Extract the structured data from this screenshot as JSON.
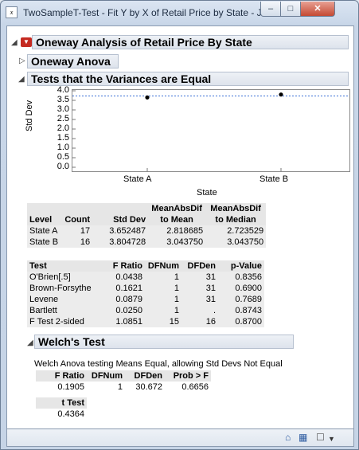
{
  "window": {
    "title": "TwoSampleT-Test - Fit Y by X of Retail Price by State - JMP",
    "controls": {
      "minimize": "–",
      "maximize": "□",
      "close": "✕"
    }
  },
  "report": {
    "main_title": "Oneway Analysis of Retail Price By State",
    "oneway_anova_title": "Oneway Anova",
    "variances_title": "Tests that the Variances are Equal",
    "welch_title": "Welch's Test"
  },
  "chart_data": {
    "type": "scatter",
    "ylabel": "Std Dev",
    "xlabel": "State",
    "ylim": [
      0,
      4
    ],
    "y_ticks": [
      "4.0",
      "3.5",
      "3.0",
      "2.5",
      "2.0",
      "1.5",
      "1.0",
      "0.5",
      "0.0"
    ],
    "categories": [
      "State A",
      "State B"
    ],
    "values": [
      3.652487,
      3.804728
    ],
    "reference_line": 3.73,
    "colors": {
      "points": "#000000",
      "reference_line": "#3b6fd6"
    }
  },
  "std_table": {
    "headers": [
      "Level",
      "Count",
      "Std Dev",
      "MeanAbsDif to Mean",
      "MeanAbsDif to Median"
    ],
    "header_lines": [
      [
        "Level"
      ],
      [
        "Count"
      ],
      [
        "Std Dev"
      ],
      [
        "MeanAbsDif",
        "to Mean"
      ],
      [
        "MeanAbsDif",
        "to Median"
      ]
    ],
    "rows": [
      [
        "State A",
        "17",
        "3.652487",
        "2.818685",
        "2.723529"
      ],
      [
        "State B",
        "16",
        "3.804728",
        "3.043750",
        "3.043750"
      ]
    ]
  },
  "test_table": {
    "headers": [
      "Test",
      "F Ratio",
      "DFNum",
      "DFDen",
      "p-Value"
    ],
    "rows": [
      [
        "O'Brien[.5]",
        "0.0438",
        "1",
        "31",
        "0.8356"
      ],
      [
        "Brown-Forsythe",
        "0.1621",
        "1",
        "31",
        "0.6900"
      ],
      [
        "Levene",
        "0.0879",
        "1",
        "31",
        "0.7689"
      ],
      [
        "Bartlett",
        "0.0250",
        "1",
        ".",
        "0.8743"
      ],
      [
        "F Test 2-sided",
        "1.0851",
        "15",
        "16",
        "0.8700"
      ]
    ]
  },
  "welch": {
    "description": "Welch Anova testing Means Equal, allowing Std Devs Not Equal",
    "headers": [
      "F Ratio",
      "DFNum",
      "DFDen",
      "Prob > F"
    ],
    "values": [
      "0.1905",
      "1",
      "30.672",
      "0.6656"
    ],
    "t_label": "t Test",
    "t_value": "0.4364"
  },
  "icons": [
    "jmp-app-icon",
    "red-triangle-icon",
    "disclosure-open-icon",
    "disclosure-closed-icon",
    "home-icon",
    "grid-icon",
    "checkbox-icon",
    "dropdown-arrow-icon"
  ]
}
